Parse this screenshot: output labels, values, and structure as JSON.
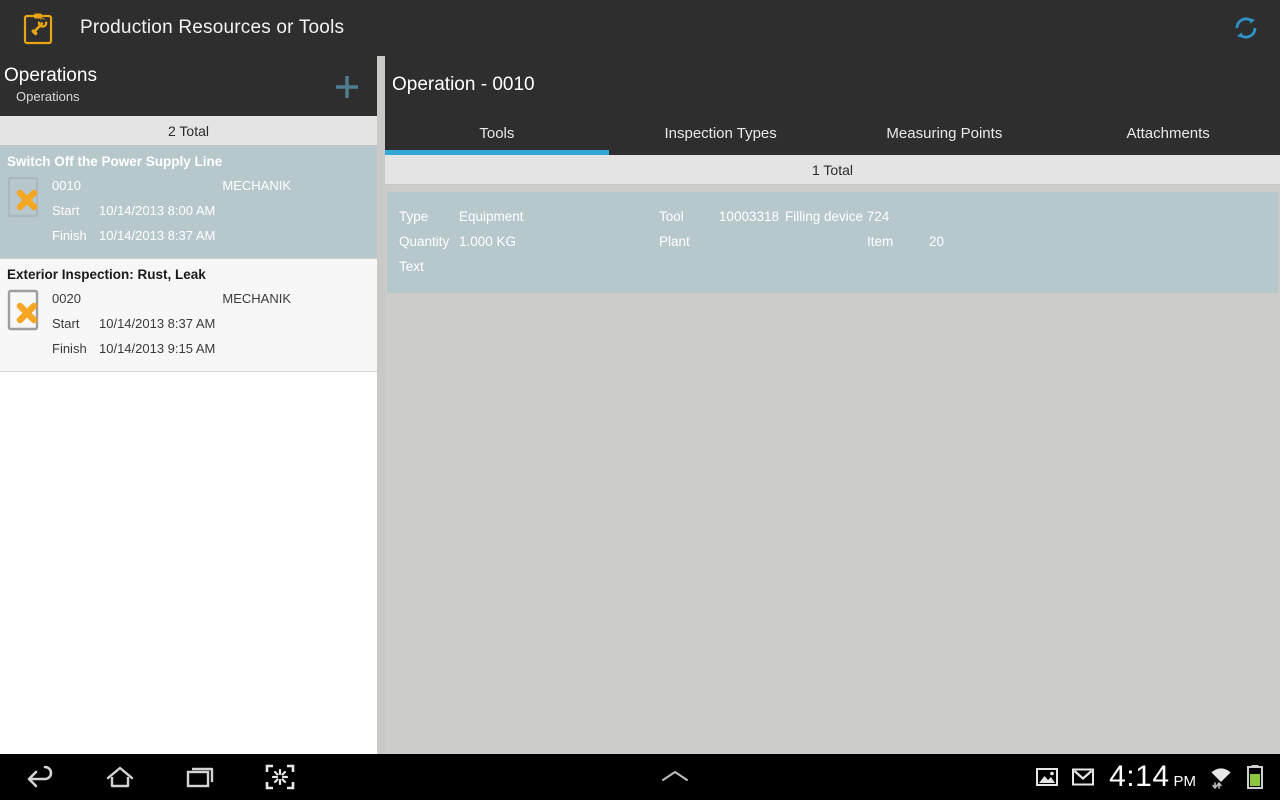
{
  "appbar": {
    "title": "Production Resources or Tools",
    "app_icon": "clipboard-wrench-icon",
    "refresh_icon": "refresh-sync-icon",
    "background": "#2e2e2e",
    "accent": "#2f93c8"
  },
  "left_panel": {
    "header": {
      "title": "Operations",
      "subtitle": "Operations",
      "add_icon": "plus-icon"
    },
    "total_label": "2 Total",
    "labels": {
      "start": "Start",
      "finish": "Finish"
    },
    "rows": [
      {
        "title": "Switch Off the Power Supply Line",
        "number": "0010",
        "work_center": "MECHANIK",
        "start": "10/14/2013 8:00 AM",
        "finish": "10/14/2013 8:37 AM",
        "status_icon": "document-error-icon",
        "selected": true
      },
      {
        "title": "Exterior Inspection: Rust, Leak",
        "number": "0020",
        "work_center": "MECHANIK",
        "start": "10/14/2013 8:37 AM",
        "finish": "10/14/2013 9:15 AM",
        "status_icon": "document-error-icon",
        "selected": false
      }
    ]
  },
  "right_panel": {
    "title": "Operation - 0010",
    "tabs": [
      {
        "label": "Tools",
        "active": true
      },
      {
        "label": "Inspection Types",
        "active": false
      },
      {
        "label": "Measuring Points",
        "active": false
      },
      {
        "label": "Attachments",
        "active": false
      }
    ],
    "total_label": "1 Total",
    "detail": {
      "type_label": "Type",
      "type_value": "Equipment",
      "tool_label": "Tool",
      "tool_number": "10003318",
      "tool_name": "Filling device 724",
      "quantity_label": "Quantity",
      "quantity_value": "1.000 KG",
      "plant_label": "Plant",
      "plant_value": "",
      "item_label": "Item",
      "item_value": "20",
      "text_label": "Text",
      "text_value": ""
    },
    "card_color": "#b7c8cd"
  },
  "navbar": {
    "back_icon": "back-arrow-icon",
    "home_icon": "home-icon",
    "recents_icon": "recent-apps-icon",
    "scan_icon": "scan-barcode-icon",
    "expand_icon": "chevron-up-icon",
    "image_icon": "image-icon",
    "mail_icon": "gmail-envelope-icon",
    "wifi_icon": "wifi-data-icon",
    "battery_icon": "battery-icon",
    "time": "4:14",
    "meridiem": "PM"
  }
}
